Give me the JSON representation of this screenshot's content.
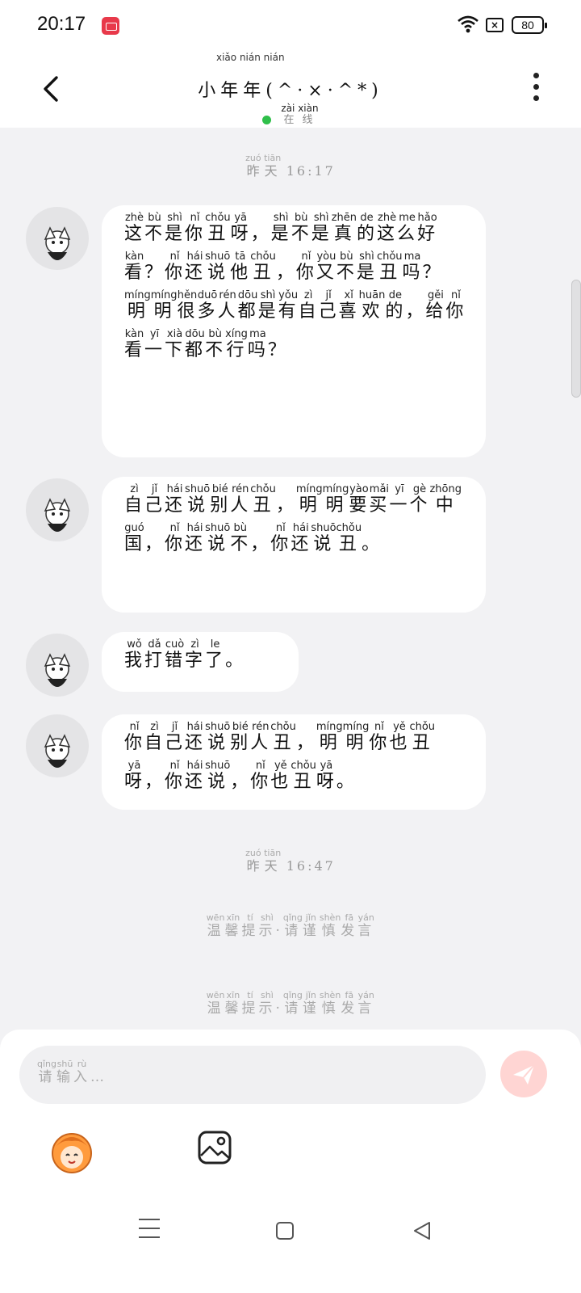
{
  "status_bar": {
    "time": "20:17",
    "battery": "80",
    "sim_icon_text": "×",
    "record_color": "#e8394a"
  },
  "header": {
    "title": "小年年(^·×·^*)",
    "title_pinyin": "xiǎo nián nián",
    "status": "在线",
    "status_pinyin": "zài xiàn",
    "online_color": "#2fbf4a"
  },
  "timestamps": [
    {
      "day": "昨天",
      "day_pinyin": "zuó tiān",
      "time": "16:17"
    },
    {
      "day": "昨天",
      "day_pinyin": "zuó tiān",
      "time": "16:47"
    }
  ],
  "messages": [
    {
      "tokens": [
        [
          "这",
          "zhè"
        ],
        [
          "不",
          "bù"
        ],
        [
          "是",
          "shì"
        ],
        [
          "你",
          "nǐ"
        ],
        [
          "丑",
          "chǒu"
        ],
        [
          "呀",
          "yā"
        ],
        [
          "，",
          ""
        ],
        [
          "是",
          "shì"
        ],
        [
          "不",
          "bù"
        ],
        [
          "是",
          "shì"
        ],
        [
          "真",
          "zhēn"
        ],
        [
          "的",
          "de"
        ],
        [
          "这",
          "zhè"
        ],
        [
          "么",
          "me"
        ],
        [
          "好",
          "hǎo"
        ],
        [
          "看",
          "kàn"
        ],
        [
          "？",
          ""
        ],
        [
          "你",
          "nǐ"
        ],
        [
          "还",
          "hái"
        ],
        [
          "说",
          "shuō"
        ],
        [
          "他",
          "tā"
        ],
        [
          "丑",
          "chǒu"
        ],
        [
          "，",
          ""
        ],
        [
          "你",
          "nǐ"
        ],
        [
          "又",
          "yòu"
        ],
        [
          "不",
          "bù"
        ],
        [
          "是",
          "shì"
        ],
        [
          "丑",
          "chǒu"
        ],
        [
          "吗",
          "ma"
        ],
        [
          "？",
          ""
        ],
        [
          "明",
          "míng"
        ],
        [
          "明",
          "míng"
        ],
        [
          "很",
          "hěn"
        ],
        [
          "多",
          "duō"
        ],
        [
          "人",
          "rén"
        ],
        [
          "都",
          "dōu"
        ],
        [
          "是",
          "shì"
        ],
        [
          "有",
          "yǒu"
        ],
        [
          "自",
          "zì"
        ],
        [
          "己",
          "jǐ"
        ],
        [
          "喜",
          "xǐ"
        ],
        [
          "欢",
          "huān"
        ],
        [
          "的",
          "de"
        ],
        [
          "，",
          ""
        ],
        [
          "给",
          "gěi"
        ],
        [
          "你",
          "nǐ"
        ],
        [
          "看",
          "kàn"
        ],
        [
          "一",
          "yī"
        ],
        [
          "下",
          "xià"
        ],
        [
          "都",
          "dōu"
        ],
        [
          "不",
          "bù"
        ],
        [
          "行",
          "xíng"
        ],
        [
          "吗",
          "ma"
        ],
        [
          "？",
          ""
        ]
      ]
    },
    {
      "tokens": [
        [
          "自",
          "zì"
        ],
        [
          "己",
          "jǐ"
        ],
        [
          "还",
          "hái"
        ],
        [
          "说",
          "shuō"
        ],
        [
          "别",
          "bié"
        ],
        [
          "人",
          "rén"
        ],
        [
          "丑",
          "chǒu"
        ],
        [
          "，",
          ""
        ],
        [
          "明",
          "míng"
        ],
        [
          "明",
          "míng"
        ],
        [
          "要",
          "yào"
        ],
        [
          "买",
          "mǎi"
        ],
        [
          "一",
          "yī"
        ],
        [
          "个",
          "gè"
        ],
        [
          "中",
          "zhōng"
        ],
        [
          "国",
          "guó"
        ],
        [
          "，",
          ""
        ],
        [
          "你",
          "nǐ"
        ],
        [
          "还",
          "hái"
        ],
        [
          "说",
          "shuō"
        ],
        [
          "不",
          "bù"
        ],
        [
          "，",
          ""
        ],
        [
          "你",
          "nǐ"
        ],
        [
          "还",
          "hái"
        ],
        [
          "说",
          "shuō"
        ],
        [
          "丑",
          "chǒu"
        ],
        [
          "。",
          ""
        ]
      ]
    },
    {
      "tokens": [
        [
          "我",
          "wǒ"
        ],
        [
          "打",
          "dǎ"
        ],
        [
          "错",
          "cuò"
        ],
        [
          "字",
          "zì"
        ],
        [
          "了",
          "le"
        ],
        [
          "。",
          ""
        ]
      ]
    },
    {
      "tokens": [
        [
          "你",
          "nǐ"
        ],
        [
          "自",
          "zì"
        ],
        [
          "己",
          "jǐ"
        ],
        [
          "还",
          "hái"
        ],
        [
          "说",
          "shuō"
        ],
        [
          "别",
          "bié"
        ],
        [
          "人",
          "rén"
        ],
        [
          "丑",
          "chǒu"
        ],
        [
          "，",
          ""
        ],
        [
          "明",
          "míng"
        ],
        [
          "明",
          "míng"
        ],
        [
          "你",
          "nǐ"
        ],
        [
          "也",
          "yě"
        ],
        [
          "丑",
          "chǒu"
        ],
        [
          "呀",
          "yā"
        ],
        [
          "，",
          ""
        ],
        [
          "你",
          "nǐ"
        ],
        [
          "还",
          "hái"
        ],
        [
          "说",
          "shuō"
        ],
        [
          "，",
          ""
        ],
        [
          "你",
          "nǐ"
        ],
        [
          "也",
          "yě"
        ],
        [
          "丑",
          "chǒu"
        ],
        [
          "呀",
          "yā"
        ],
        [
          "。",
          ""
        ]
      ]
    }
  ],
  "tips": [
    {
      "tokens": [
        [
          "温",
          "wēn"
        ],
        [
          "馨",
          "xīn"
        ],
        [
          "提",
          "tí"
        ],
        [
          "示",
          "shì"
        ],
        [
          "·",
          ""
        ],
        [
          "请",
          "qǐng"
        ],
        [
          "谨",
          "jǐn"
        ],
        [
          "慎",
          "shèn"
        ],
        [
          "发",
          "fā"
        ],
        [
          "言",
          "yán"
        ]
      ]
    },
    {
      "tokens": [
        [
          "温",
          "wēn"
        ],
        [
          "馨",
          "xīn"
        ],
        [
          "提",
          "tí"
        ],
        [
          "示",
          "shì"
        ],
        [
          "·",
          ""
        ],
        [
          "请",
          "qǐng"
        ],
        [
          "谨",
          "jǐn"
        ],
        [
          "慎",
          "shèn"
        ],
        [
          "发",
          "fā"
        ],
        [
          "言",
          "yán"
        ]
      ]
    }
  ],
  "input": {
    "placeholder_tokens": [
      [
        "请",
        "qǐng"
      ],
      [
        "输",
        "shū"
      ],
      [
        "入",
        "rù"
      ],
      [
        "…",
        ""
      ]
    ],
    "send_color": "#ffd5d3"
  },
  "icons": {
    "back": "chevron-left-icon",
    "more": "more-vertical-icon",
    "emoji": "emoji-sticker-icon",
    "image": "image-icon",
    "send": "send-icon"
  }
}
